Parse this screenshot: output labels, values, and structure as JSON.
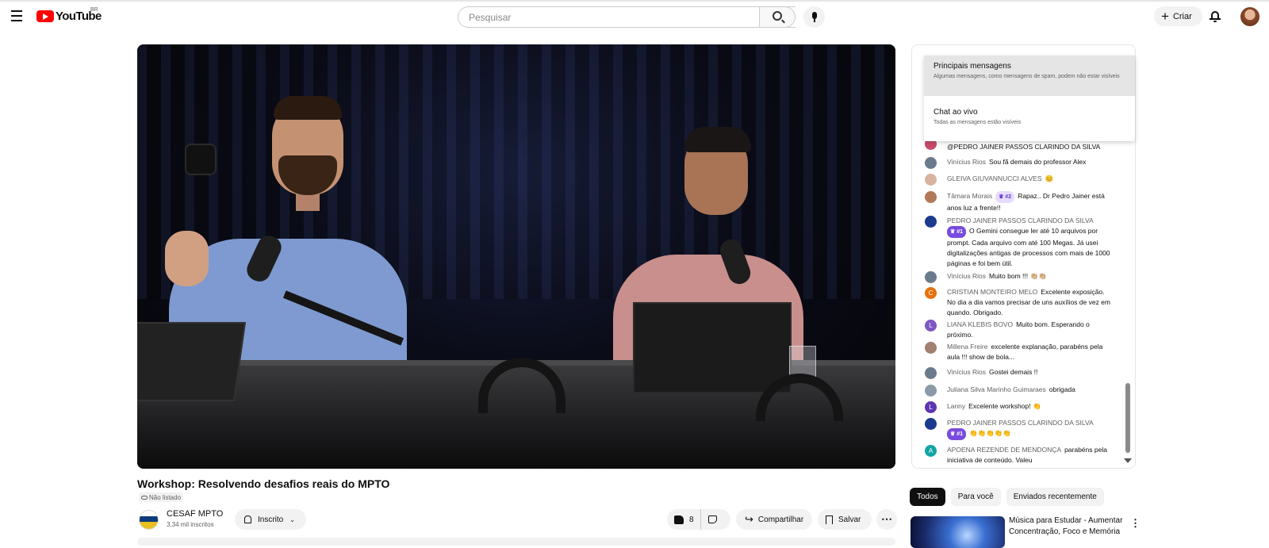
{
  "header": {
    "logo_text": "YouTube",
    "country_code": "BR",
    "search_placeholder": "Pesquisar",
    "create_label": "Criar"
  },
  "video": {
    "title": "Workshop: Resolvendo desafios reais do MPTO",
    "visibility": "Não listado"
  },
  "channel": {
    "name": "CESAF MPTO",
    "subscribers": "3,34 mil inscritos",
    "subscribe_label": "Inscrito"
  },
  "actions": {
    "likes": "8",
    "share_label": "Compartilhar",
    "save_label": "Salvar",
    "more_label": "⋯"
  },
  "chat_mode_menu": {
    "items": [
      {
        "label": "Principais mensagens",
        "description": "Algumas mensagens, como mensagens de spam, podem não estar visíveis",
        "selected": true
      },
      {
        "label": "Chat ao vivo",
        "description": "Todas as mensagens estão visíveis",
        "selected": false
      }
    ]
  },
  "chat": {
    "messages": [
      {
        "author": "",
        "badge": "",
        "text": "@PEDRO JAINER PASSOS CLARINDO DA SILVA",
        "avatar_color": "#c94a6b"
      },
      {
        "author": "Vinícius Rios",
        "badge": "",
        "text": "Sou fã demais do professor Alex",
        "avatar_color": "#6a7b8c"
      },
      {
        "author": "GLEIVA GIUVANNUCCI ALVES",
        "badge": "",
        "text": "😊",
        "avatar_color": "#d8b4a0"
      },
      {
        "author": "Tâmara Morais",
        "badge": "#2",
        "text": "Rapaz.. Dr Pedro Jainer está anos luz a frente!!",
        "avatar_color": "#b07a5a"
      },
      {
        "author": "PEDRO JAINER PASSOS CLARINDO DA SILVA",
        "badge": "#1",
        "text": "O Gemini consegue ler até 10 arquivos por prompt. Cada arquivo com até 100 Megas. Já usei digitalizações antigas de processos com mais de 1000 páginas e foi bem útil.",
        "avatar_color": "#1c3b8f"
      },
      {
        "author": "Vinícius Rios",
        "badge": "",
        "text": "Muito bom !!! 👏🏼👏🏼",
        "avatar_color": "#6a7b8c"
      },
      {
        "author": "CRISTIAN MONTEIRO MELO",
        "badge": "",
        "text": "Excelente exposição. No dia a dia vamos precisar de uns auxílios de vez em quando. Obrigado.",
        "avatar_color": "#e8710a",
        "initial": "C"
      },
      {
        "author": "LIANA KLEBIS BOVO",
        "badge": "",
        "text": "Muito bom. Esperando o próximo.",
        "avatar_color": "#7e57c2",
        "initial": "L"
      },
      {
        "author": "Millena Freire",
        "badge": "",
        "text": "excelente explanação, parabéns pela aula !!! show de bola...",
        "avatar_color": "#a08070"
      },
      {
        "author": "Vinícius Rios",
        "badge": "",
        "text": "Gostei demais !!",
        "avatar_color": "#6a7b8c"
      },
      {
        "author": "Juliana Silva Marinho Guimaraes",
        "badge": "",
        "text": "obrigada",
        "avatar_color": "#8a9aa8"
      },
      {
        "author": "Lanny",
        "badge": "",
        "text": "Excelente workshop! 👏",
        "avatar_color": "#5e35b1",
        "initial": "L"
      },
      {
        "author": "PEDRO JAINER PASSOS CLARINDO DA SILVA",
        "badge": "#1",
        "text": "👏👏👏👏👏",
        "avatar_color": "#1c3b8f"
      },
      {
        "author": "APOENA REZENDE DE MENDONÇA",
        "badge": "",
        "text": "parabéns pela iniciativa de conteúdo. Valeu",
        "avatar_color": "#12a4a4",
        "initial": "A"
      }
    ]
  },
  "filter_chips": [
    "Todos",
    "Para você",
    "Enviados recentemente"
  ],
  "recommendation": {
    "title": "Música para Estudar - Aumentar Concentração, Foco e Memória"
  },
  "colors": {
    "brand_red": "#ff0000",
    "member_badge": "#e8dbff",
    "member_badge_solid": "#7a4be0"
  }
}
